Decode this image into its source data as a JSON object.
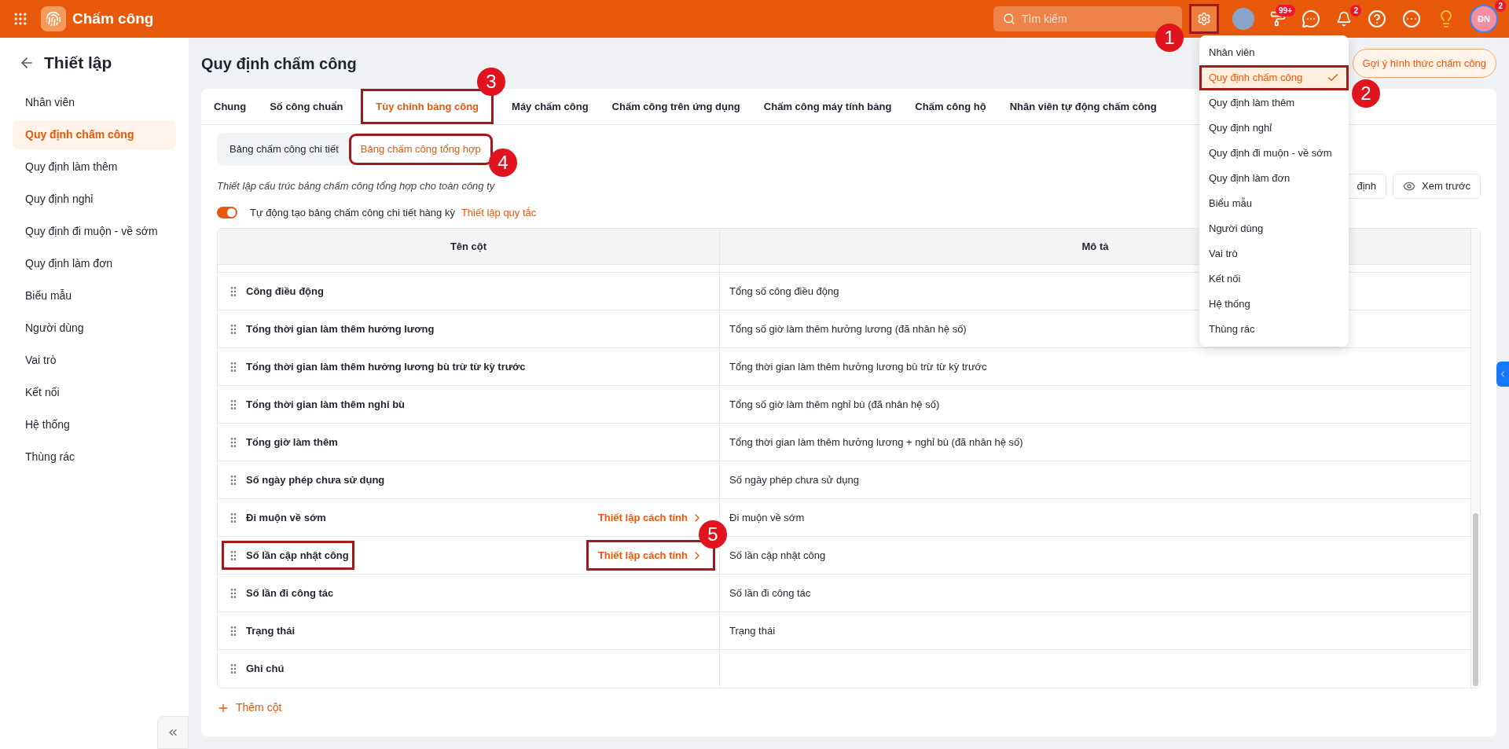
{
  "app": {
    "title": "Chấm công"
  },
  "topbar": {
    "search": {
      "placeholder": "Tìm kiếm"
    },
    "settings_callout": "1",
    "tasks_badge": "99+",
    "notifications_badge": "2",
    "profile_badge": "2",
    "profile_initials": "ĐN"
  },
  "sidebar": {
    "title": "Thiết lập",
    "items": [
      {
        "label": "Nhân viên",
        "selected": false
      },
      {
        "label": "Quy định chấm công",
        "selected": true
      },
      {
        "label": "Quy định làm thêm",
        "selected": false
      },
      {
        "label": "Quy định nghỉ",
        "selected": false
      },
      {
        "label": "Quy định đi muộn - về sớm",
        "selected": false
      },
      {
        "label": "Quy định làm đơn",
        "selected": false
      },
      {
        "label": "Biểu mẫu",
        "selected": false
      },
      {
        "label": "Người dùng",
        "selected": false
      },
      {
        "label": "Vai trò",
        "selected": false
      },
      {
        "label": "Kết nối",
        "selected": false
      },
      {
        "label": "Hệ thống",
        "selected": false
      },
      {
        "label": "Thùng rác",
        "selected": false
      }
    ]
  },
  "page": {
    "title": "Quy định chấm công",
    "hint_button": "Gợi ý hình thức chấm công"
  },
  "tabs": [
    {
      "label": "Chung",
      "selected": false
    },
    {
      "label": "Số công chuẩn",
      "selected": false
    },
    {
      "label": "Tùy chỉnh bảng công",
      "selected": true,
      "callout": "3"
    },
    {
      "label": "Máy chấm công",
      "selected": false
    },
    {
      "label": "Chấm công trên ứng dụng",
      "selected": false
    },
    {
      "label": "Chấm công máy tính bảng",
      "selected": false
    },
    {
      "label": "Chấm công hộ",
      "selected": false
    },
    {
      "label": "Nhân viên tự động chấm công",
      "selected": false
    }
  ],
  "subtabs": [
    {
      "label": "Bảng chấm công chi tiết",
      "selected": false
    },
    {
      "label": "Bảng chấm công tổng hợp",
      "selected": true,
      "callout": "4"
    }
  ],
  "description": "Thiết lập cấu trúc bảng chấm công tổng hợp cho toàn công ty",
  "toolbar_buttons": [
    {
      "kind": "plain",
      "label": "định"
    },
    {
      "kind": "preview",
      "label": "Xem trước"
    }
  ],
  "auto_toggle": {
    "on": true,
    "label": "Tự động tạo bảng chấm công chi tiết hàng kỳ",
    "link": "Thiết lập quy tắc"
  },
  "table": {
    "columns": [
      "Tên cột",
      "Mô tả"
    ],
    "rows": [
      {
        "name": "Công điều động",
        "description": "Tổng số công điều động"
      },
      {
        "name": "Tổng thời gian làm thêm hưởng lương",
        "description": "Tổng số giờ làm thêm hưởng lương (đã nhân hệ số)"
      },
      {
        "name": "Tổng thời gian làm thêm hưởng lương bù trừ từ kỳ trước",
        "description": "Tổng thời gian làm thêm hưởng lương bù trừ từ kỳ trước"
      },
      {
        "name": "Tổng thời gian làm thêm nghỉ bù",
        "description": "Tổng số giờ làm thêm nghỉ bù (đã nhân hệ số)"
      },
      {
        "name": "Tổng giờ làm thêm",
        "description": "Tổng thời gian làm thêm hưởng lương + nghỉ bù (đã nhân hệ số)"
      },
      {
        "name": "Số ngày phép chưa sử dụng",
        "description": "Số ngày phép chưa sử dụng"
      },
      {
        "name": "Đi muộn về sớm",
        "description": "Đi muộn về sớm",
        "action": {
          "label": "Thiết lập cách tính"
        }
      },
      {
        "name": "Số lần cập nhật công",
        "description": "Số lần cập nhật công",
        "outlined": true,
        "action": {
          "label": "Thiết lập cách tính",
          "callout": "5"
        }
      },
      {
        "name": "Số lần đi công tác",
        "description": "Số lần đi công tác"
      },
      {
        "name": "Trạng thái",
        "description": "Trạng thái"
      },
      {
        "name": "Ghi chú"
      }
    ]
  },
  "add_column": "Thêm cột",
  "settings_menu": {
    "items": [
      {
        "label": "Nhân viên",
        "selected": false
      },
      {
        "label": "Quy định chấm công",
        "selected": true,
        "callout": "2"
      },
      {
        "label": "Quy định làm thêm",
        "selected": false
      },
      {
        "label": "Quy định nghỉ",
        "selected": false
      },
      {
        "label": "Quy định đi muộn - về sớm",
        "selected": false
      },
      {
        "label": "Quy định làm đơn",
        "selected": false
      },
      {
        "label": "Biểu mẫu",
        "selected": false
      },
      {
        "label": "Người dùng",
        "selected": false
      },
      {
        "label": "Vai trò",
        "selected": false
      },
      {
        "label": "Kết nối",
        "selected": false
      },
      {
        "label": "Hệ thống",
        "selected": false
      },
      {
        "label": "Thùng rác",
        "selected": false
      }
    ]
  }
}
